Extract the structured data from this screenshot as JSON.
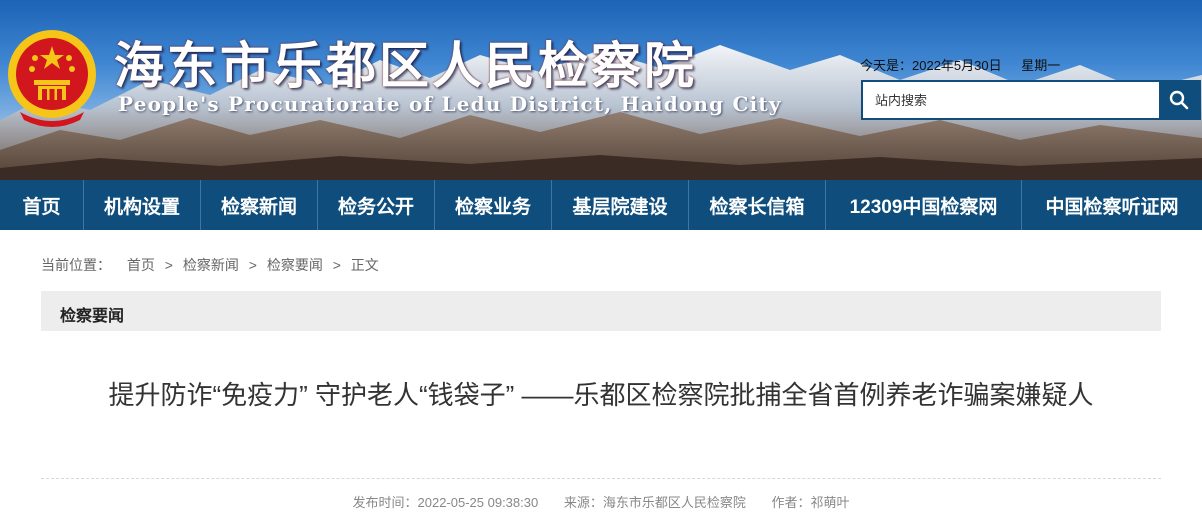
{
  "header": {
    "site_title": "海东市乐都区人民检察院",
    "site_subtitle": "People's Procuratorate of Ledu District, Haidong City",
    "date_label": "今天是：2022年5月30日",
    "weekday": "星期一",
    "search_placeholder": "站内搜索",
    "search_icon": "search-icon"
  },
  "nav": {
    "items": [
      {
        "label": "首页"
      },
      {
        "label": "机构设置"
      },
      {
        "label": "检察新闻"
      },
      {
        "label": "检务公开"
      },
      {
        "label": "检察业务"
      },
      {
        "label": "基层院建设"
      },
      {
        "label": "检察长信箱"
      },
      {
        "label": "12309中国检察网"
      },
      {
        "label": "中国检察听证网"
      }
    ]
  },
  "breadcrumb": {
    "label": "当前位置：",
    "items": [
      "首页",
      "检察新闻",
      "检察要闻"
    ],
    "current": "正文",
    "separator": ">"
  },
  "section": {
    "title": "检察要闻"
  },
  "article": {
    "title": "提升防诈“免疫力” 守护老人“钱袋子” ——乐都区检察院批捕全省首例养老诈骗案嫌疑人",
    "publish_time": "发布时间：2022-05-25 09:38:30",
    "source": "来源：海东市乐都区人民检察院",
    "author": "作者：祁萌叶"
  },
  "colors": {
    "nav_background": "#0f4e7c",
    "section_bar": "#ededed",
    "emblem_red": "#d2161e",
    "emblem_gold": "#f5c518"
  }
}
